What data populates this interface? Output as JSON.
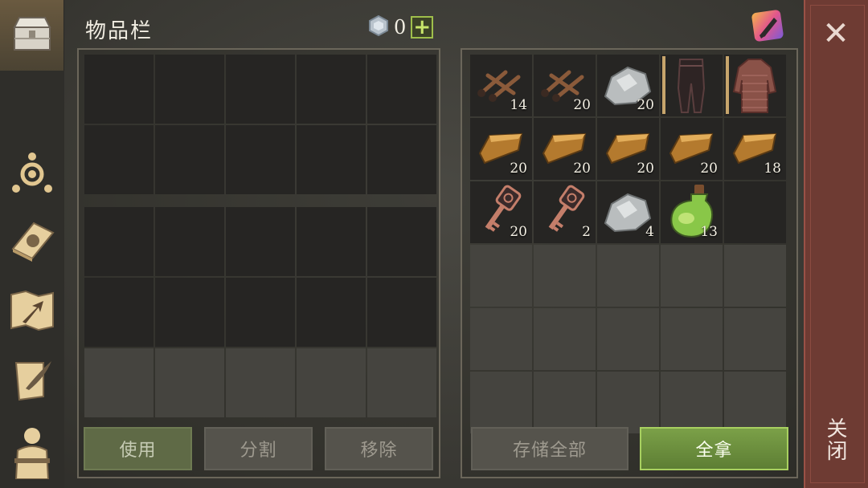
{
  "header": {
    "title": "物品栏",
    "currency_value": "0",
    "currency_plus_label": "+"
  },
  "sidebar": {
    "items": [
      {
        "name": "chest-icon",
        "active": true
      },
      {
        "name": "skills-icon",
        "active": false
      },
      {
        "name": "sun-book-icon",
        "active": false
      },
      {
        "name": "map-arrow-icon",
        "active": false
      },
      {
        "name": "scroll-quill-icon",
        "active": false
      },
      {
        "name": "character-icon",
        "active": false
      }
    ]
  },
  "loot": {
    "slots": [
      {
        "item": "nails",
        "count": "14"
      },
      {
        "item": "nails",
        "count": "20"
      },
      {
        "item": "stone",
        "count": "20"
      },
      {
        "item": "leather-pants",
        "count": ""
      },
      {
        "item": "chainmail-shirt",
        "count": ""
      },
      {
        "item": "copper-ingot",
        "count": "20"
      },
      {
        "item": "copper-ingot",
        "count": "20"
      },
      {
        "item": "copper-ingot",
        "count": "20"
      },
      {
        "item": "copper-ingot",
        "count": "20"
      },
      {
        "item": "copper-ingot",
        "count": "18"
      },
      {
        "item": "ornate-key",
        "count": "20"
      },
      {
        "item": "ornate-key",
        "count": "2"
      },
      {
        "item": "stone",
        "count": "4"
      },
      {
        "item": "green-potion",
        "count": "13"
      }
    ]
  },
  "buttons": {
    "use": "使用",
    "split": "分割",
    "remove": "移除",
    "store_all": "存储全部",
    "take_all": "全拿"
  },
  "close": {
    "x": "✕",
    "label": "关闭"
  },
  "colors": {
    "take_all_green": "#7ba048",
    "close_strip": "#6e3b33",
    "plus_green": "#9fbf4b"
  }
}
